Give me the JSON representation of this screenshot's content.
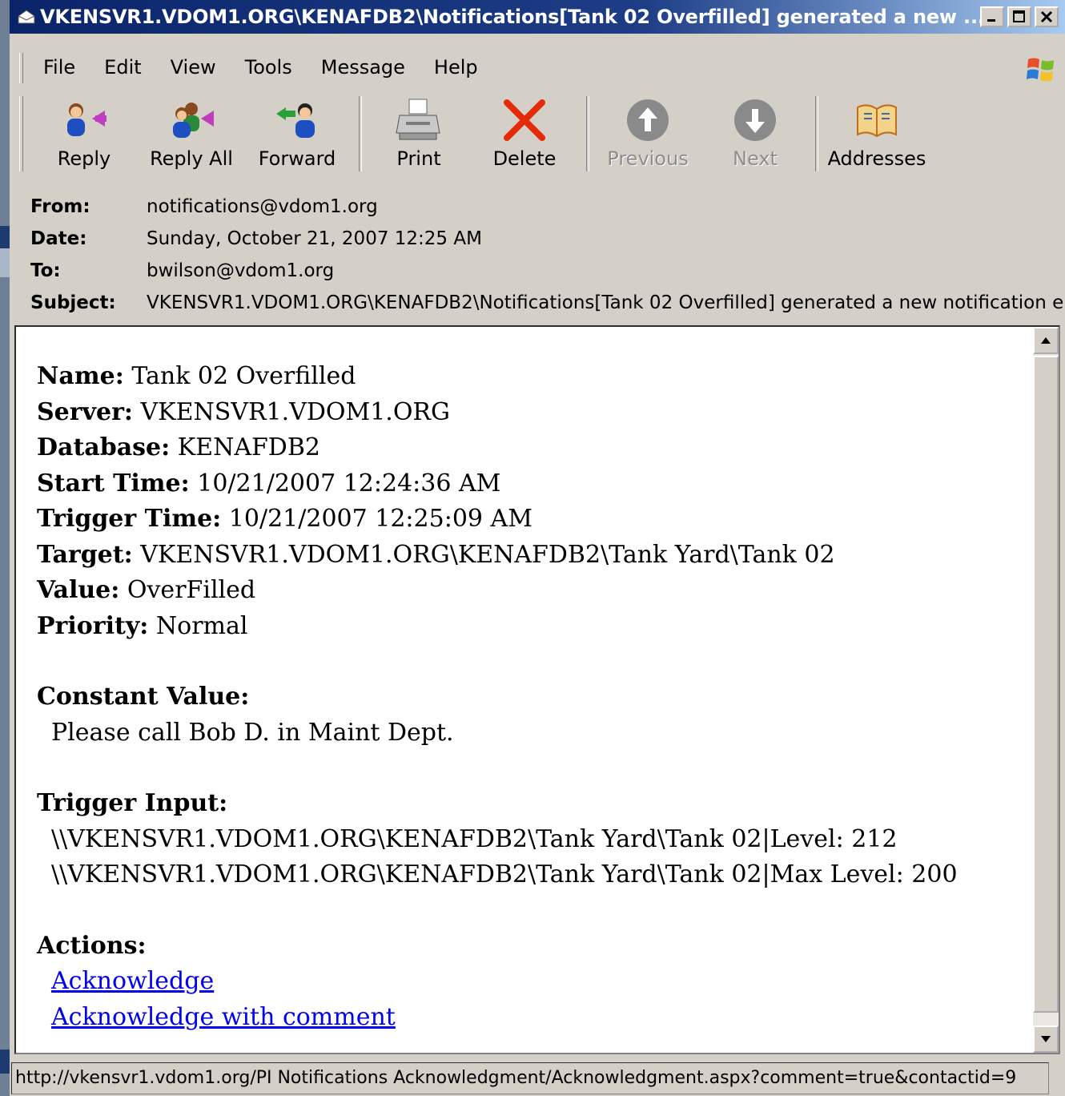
{
  "window": {
    "title": "VKENSVR1.VDOM1.ORG\\KENAFDB2\\Notifications[Tank 02 Overfilled] generated a new ..."
  },
  "menu": [
    "File",
    "Edit",
    "View",
    "Tools",
    "Message",
    "Help"
  ],
  "toolbar": {
    "reply": "Reply",
    "reply_all": "Reply All",
    "forward": "Forward",
    "print": "Print",
    "delete": "Delete",
    "previous": "Previous",
    "next": "Next",
    "addresses": "Addresses"
  },
  "header": {
    "from_label": "From:",
    "from": "notifications@vdom1.org",
    "date_label": "Date:",
    "date": "Sunday, October 21, 2007 12:25 AM",
    "to_label": "To:",
    "to": "bwilson@vdom1.org",
    "subject_label": "Subject:",
    "subject": "VKENSVR1.VDOM1.ORG\\KENAFDB2\\Notifications[Tank 02 Overfilled] generated a new notification e"
  },
  "message": {
    "name_label": "Name:",
    "name": "Tank 02 Overfilled",
    "server_label": "Server:",
    "server": "VKENSVR1.VDOM1.ORG",
    "database_label": "Database:",
    "database": "KENAFDB2",
    "start_label": "Start Time:",
    "start": "10/21/2007 12:24:36 AM",
    "trigger_label": "Trigger Time:",
    "trigger": "10/21/2007 12:25:09 AM",
    "target_label": "Target:",
    "target": "VKENSVR1.VDOM1.ORG\\KENAFDB2\\Tank Yard\\Tank 02",
    "value_label": "Value:",
    "value": "OverFilled",
    "priority_label": "Priority:",
    "priority": "Normal",
    "constant_label": "Constant Value:",
    "constant": "Please call Bob D. in Maint Dept.",
    "trigger_input_label": "Trigger Input:",
    "trigger_inputs": [
      "\\\\VKENSVR1.VDOM1.ORG\\KENAFDB2\\Tank Yard\\Tank 02|Level: 212",
      "\\\\VKENSVR1.VDOM1.ORG\\KENAFDB2\\Tank Yard\\Tank 02|Max Level: 200"
    ],
    "actions_label": "Actions:",
    "actions": [
      "Acknowledge",
      "Acknowledge with comment"
    ]
  },
  "status": "http://vkensvr1.vdom1.org/PI Notifications Acknowledgment/Acknowledgment.aspx?comment=true&contactid=9"
}
